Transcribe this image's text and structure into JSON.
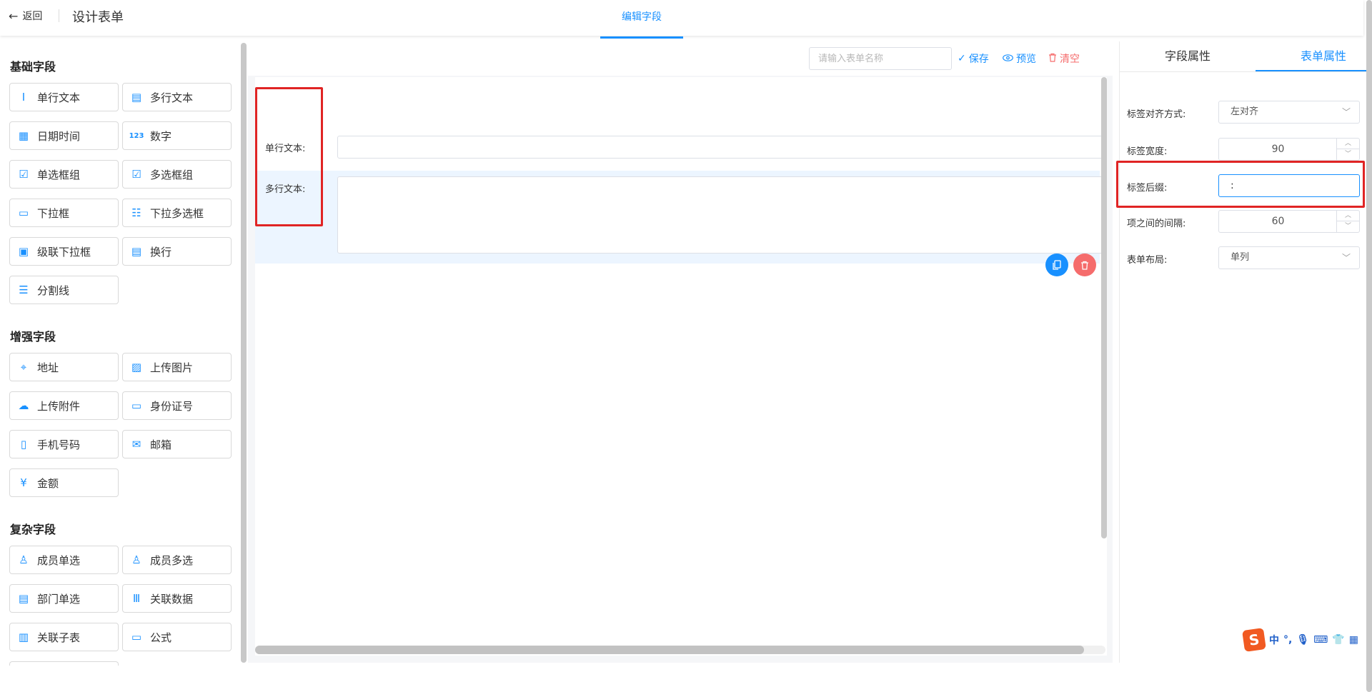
{
  "header": {
    "back_label": "返回",
    "title": "设计表单",
    "active_tab": "编辑字段"
  },
  "palette": {
    "sections": [
      {
        "title": "基础字段"
      },
      {
        "title": "增强字段"
      },
      {
        "title": "复杂字段"
      }
    ],
    "basic": [
      {
        "label": "单行文本",
        "icon": "text-icon"
      },
      {
        "label": "多行文本",
        "icon": "textarea-icon"
      },
      {
        "label": "日期时间",
        "icon": "calendar-icon"
      },
      {
        "label": "数字",
        "icon": "number-icon"
      },
      {
        "label": "单选框组",
        "icon": "radio-icon"
      },
      {
        "label": "多选框组",
        "icon": "checkbox-icon"
      },
      {
        "label": "下拉框",
        "icon": "select-icon"
      },
      {
        "label": "下拉多选框",
        "icon": "multi-select-icon"
      },
      {
        "label": "级联下拉框",
        "icon": "cascader-icon"
      },
      {
        "label": "换行",
        "icon": "newline-icon"
      },
      {
        "label": "分割线",
        "icon": "divider-icon"
      }
    ],
    "enhanced": [
      {
        "label": "地址",
        "icon": "location-icon"
      },
      {
        "label": "上传图片",
        "icon": "image-icon"
      },
      {
        "label": "上传附件",
        "icon": "upload-icon"
      },
      {
        "label": "身份证号",
        "icon": "id-card-icon"
      },
      {
        "label": "手机号码",
        "icon": "phone-icon"
      },
      {
        "label": "邮箱",
        "icon": "mail-icon"
      },
      {
        "label": "金额",
        "icon": "money-icon"
      }
    ],
    "complex": [
      {
        "label": "成员单选",
        "icon": "user-icon"
      },
      {
        "label": "成员多选",
        "icon": "users-icon"
      },
      {
        "label": "部门单选",
        "icon": "department-icon"
      },
      {
        "label": "关联数据",
        "icon": "barcode-icon"
      },
      {
        "label": "关联子表",
        "icon": "subtable-icon"
      },
      {
        "label": "公式",
        "icon": "formula-icon"
      }
    ]
  },
  "toolbar": {
    "form_name_placeholder": "请输入表单名称",
    "save_label": "保存",
    "preview_label": "预览",
    "clear_label": "清空"
  },
  "form": {
    "fields": [
      {
        "label": "单行文本:"
      },
      {
        "label": "多行文本:"
      }
    ]
  },
  "properties": {
    "tabs": [
      "字段属性",
      "表单属性"
    ],
    "active_tab_index": 1,
    "label_align": {
      "label": "标签对齐方式:",
      "value": "左对齐"
    },
    "label_width": {
      "label": "标签宽度:",
      "value": "90"
    },
    "label_suffix": {
      "label": "标签后缀:",
      "value": ":"
    },
    "item_gap": {
      "label": "项之间的间隔:",
      "value": "60"
    },
    "layout": {
      "label": "表单布局:",
      "value": "单列"
    }
  },
  "ime": {
    "items": [
      "中",
      "°,"
    ]
  },
  "colors": {
    "accent": "#1890ff",
    "danger": "#f56c6c",
    "highlight": "#e02424"
  }
}
